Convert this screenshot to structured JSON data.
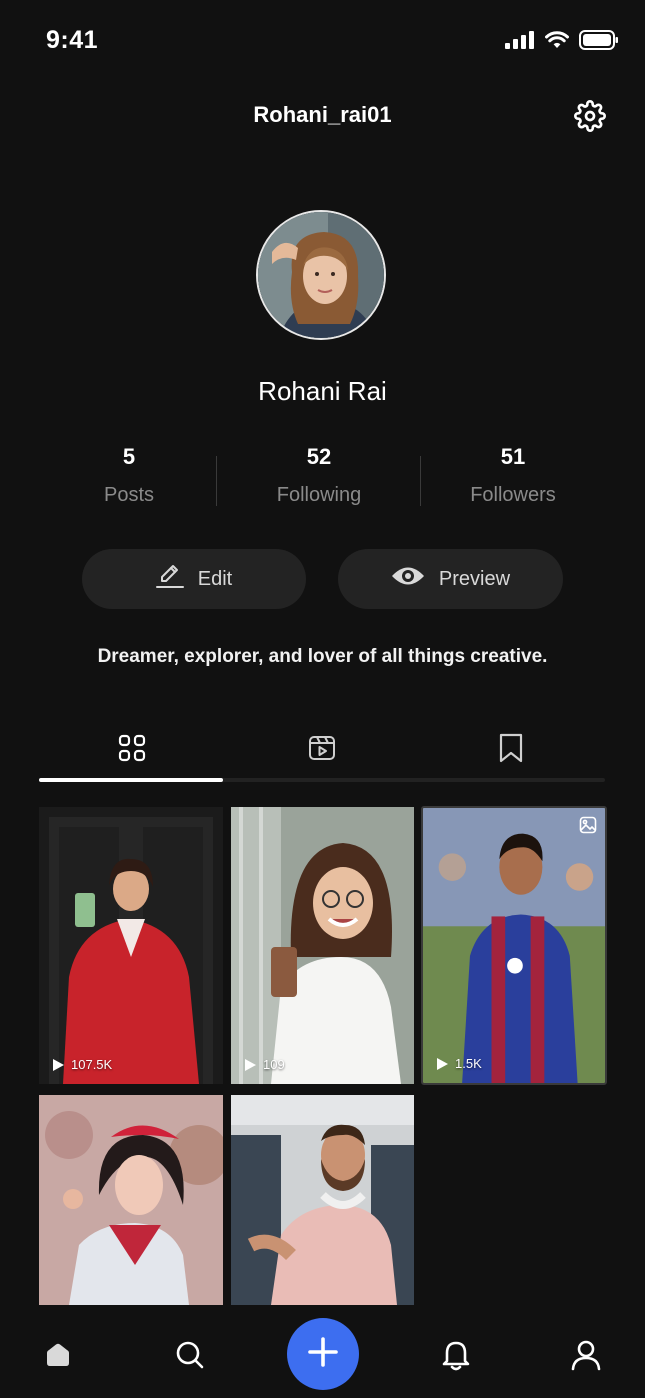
{
  "status_bar": {
    "time": "9:41"
  },
  "header": {
    "username": "Rohani_rai01",
    "settings_icon": "gear-icon"
  },
  "profile": {
    "name": "Rohani Rai",
    "stats": [
      {
        "value": "5",
        "label": "Posts"
      },
      {
        "value": "52",
        "label": "Following"
      },
      {
        "value": "51",
        "label": "Followers"
      }
    ],
    "edit_label": "Edit",
    "preview_label": "Preview",
    "bio": "Dreamer, explorer, and lover of all things creative."
  },
  "tabs": [
    {
      "icon": "grid-icon",
      "active": true
    },
    {
      "icon": "reels-icon",
      "active": false
    },
    {
      "icon": "bookmark-icon",
      "active": false
    }
  ],
  "posts": [
    {
      "views": "107.5K",
      "type": "video"
    },
    {
      "views": "109",
      "type": "video"
    },
    {
      "views": "1.5K",
      "type": "image"
    },
    {
      "views": "",
      "type": "photo"
    },
    {
      "views": "",
      "type": "photo"
    }
  ],
  "bottom_nav": [
    {
      "icon": "home-icon"
    },
    {
      "icon": "search-icon"
    },
    {
      "icon": "plus-icon"
    },
    {
      "icon": "bell-icon"
    },
    {
      "icon": "user-icon"
    }
  ],
  "colors": {
    "background": "#111111",
    "accent": "#3d6ef0",
    "muted": "#8a8a8a",
    "button": "#232323"
  }
}
